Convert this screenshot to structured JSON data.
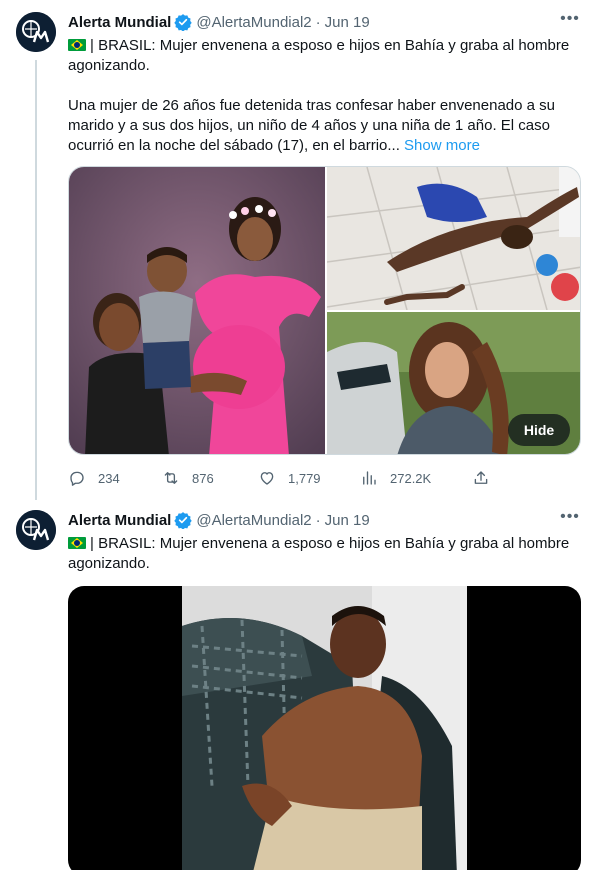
{
  "tweets": [
    {
      "author": {
        "name": "Alerta Mundial",
        "handle": "@AlertaMundial2",
        "avatar_icon": "alerta-mundial-logo-icon",
        "verified": true
      },
      "dot": "·",
      "date": "Jun 19",
      "title_line": "| BRASIL: Mujer envenena a esposo e hijos en Bahía y graba al hombre agonizando.",
      "body": "Una mujer de 26 años fue detenida tras confesar haber envenenado a su marido y a sus dos hijos, un niño de 4 años y una niña de 1 año. El caso ocurrió en la noche del sábado (17), en el barrio...",
      "show_more": "Show more",
      "media_hide_label": "Hide",
      "stats": {
        "replies": "234",
        "retweets": "876",
        "likes": "1,779",
        "views": "272.2K"
      }
    },
    {
      "author": {
        "name": "Alerta Mundial",
        "handle": "@AlertaMundial2",
        "avatar_icon": "alerta-mundial-logo-icon",
        "verified": true
      },
      "dot": "·",
      "date": "Jun 19",
      "title_line": "| BRASIL: Mujer envenena a esposo e hijos en Bahía y graba al hombre agonizando."
    }
  ],
  "colors": {
    "accent": "#1d9bf0",
    "secondary_text": "#536471",
    "border": "#cfd9de",
    "verified": "#1d9bf0"
  }
}
